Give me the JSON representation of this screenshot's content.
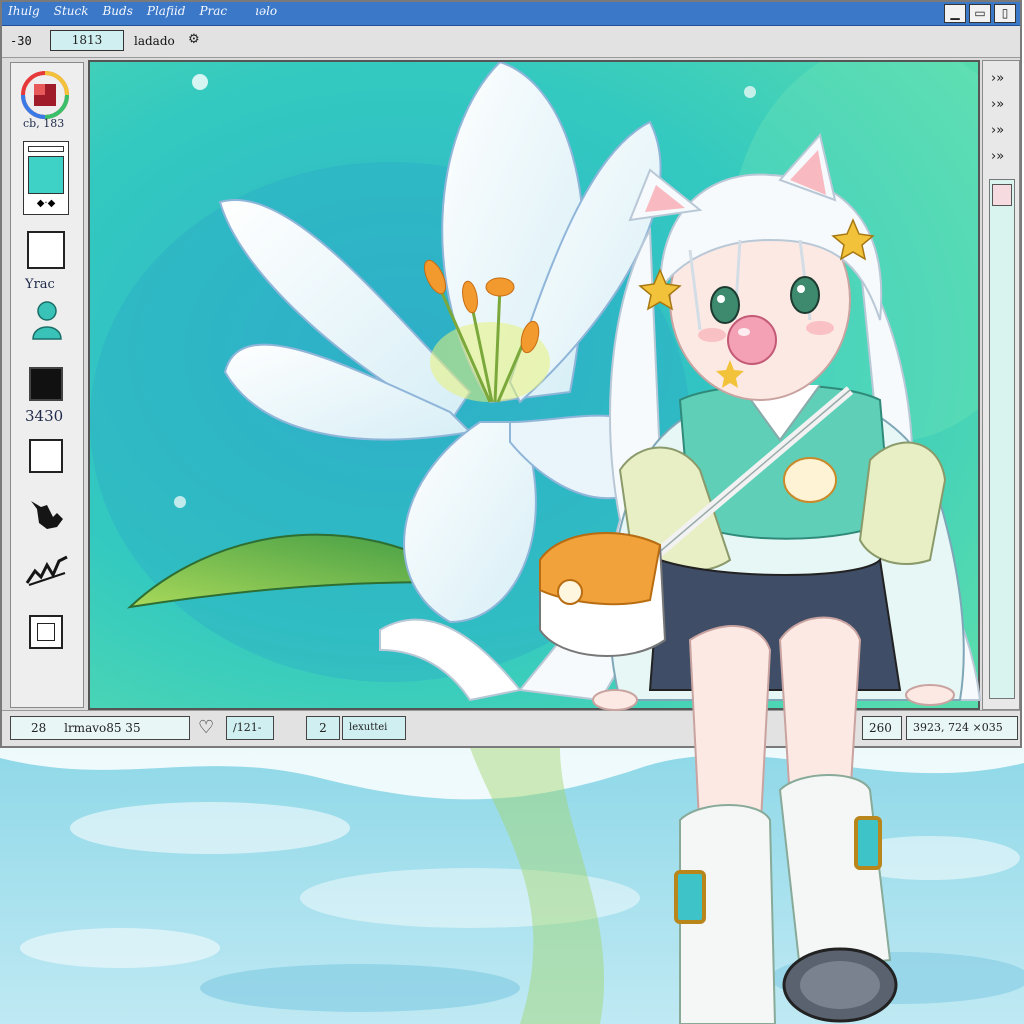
{
  "titlebar": {
    "menu": [
      "Ihulg",
      "Stuck",
      "Buds",
      "Plafiid",
      "Prac",
      "ıəlo"
    ],
    "buttons": [
      "▁",
      "▭",
      "▯"
    ]
  },
  "toolbar": {
    "zoom": "-30",
    "field_value": "1813",
    "label": "ladado",
    "icon": "settings-icon"
  },
  "tools": {
    "color_code": "cb, 183",
    "frame_label": "Yrac",
    "size_label": "3430"
  },
  "right_panel": {
    "arrows": [
      "›»",
      "›»",
      "›»",
      "›»"
    ]
  },
  "statusbar": {
    "layer": "28",
    "filename": "lrmavo85 35",
    "heart": "♡",
    "pos": "/121-",
    "page": "2",
    "mode": "lexuttei",
    "zoom": "260",
    "coords": "3923, 724 ×035"
  },
  "colors": {
    "titlebar": "#3b78c8",
    "canvas_bg": "#3fd0c4",
    "accent": "#f2a23a",
    "bubble": "#f4a0b5"
  }
}
